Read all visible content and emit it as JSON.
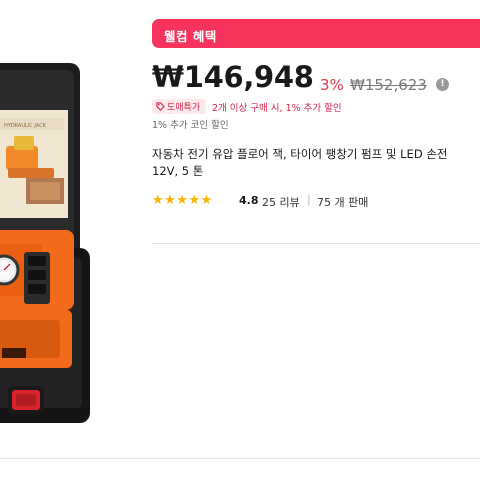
{
  "banner": {
    "label": "웰컴 혜택"
  },
  "price": {
    "current": "₩146,948",
    "discount": "3%",
    "original": "₩152,623",
    "info_icon": "info-icon"
  },
  "promotion": {
    "badge": "도매특가",
    "text": "2개 이상 구매 시, 1% 추가 할인",
    "coin": "1% 추가 코인 할인"
  },
  "product": {
    "title_lines": [
      "자동차 전기 유압 플로어 잭, 타이어 팽창기 펌프 및 LED 손전",
      "12V, 5 톤"
    ]
  },
  "rating": {
    "stars": "★★★★★",
    "score": "4.8",
    "reviews": "25 리뷰",
    "separator": "|",
    "sold": "75 개 판매"
  },
  "colors": {
    "accent": "#f5335d",
    "price_red": "#e8374a",
    "star": "#f7b500",
    "case_black": "#1a1a1a",
    "body_orange": "#f26a1b"
  },
  "icons": {
    "tag": "tag-icon",
    "info": "info-icon",
    "star": "star-icon"
  }
}
